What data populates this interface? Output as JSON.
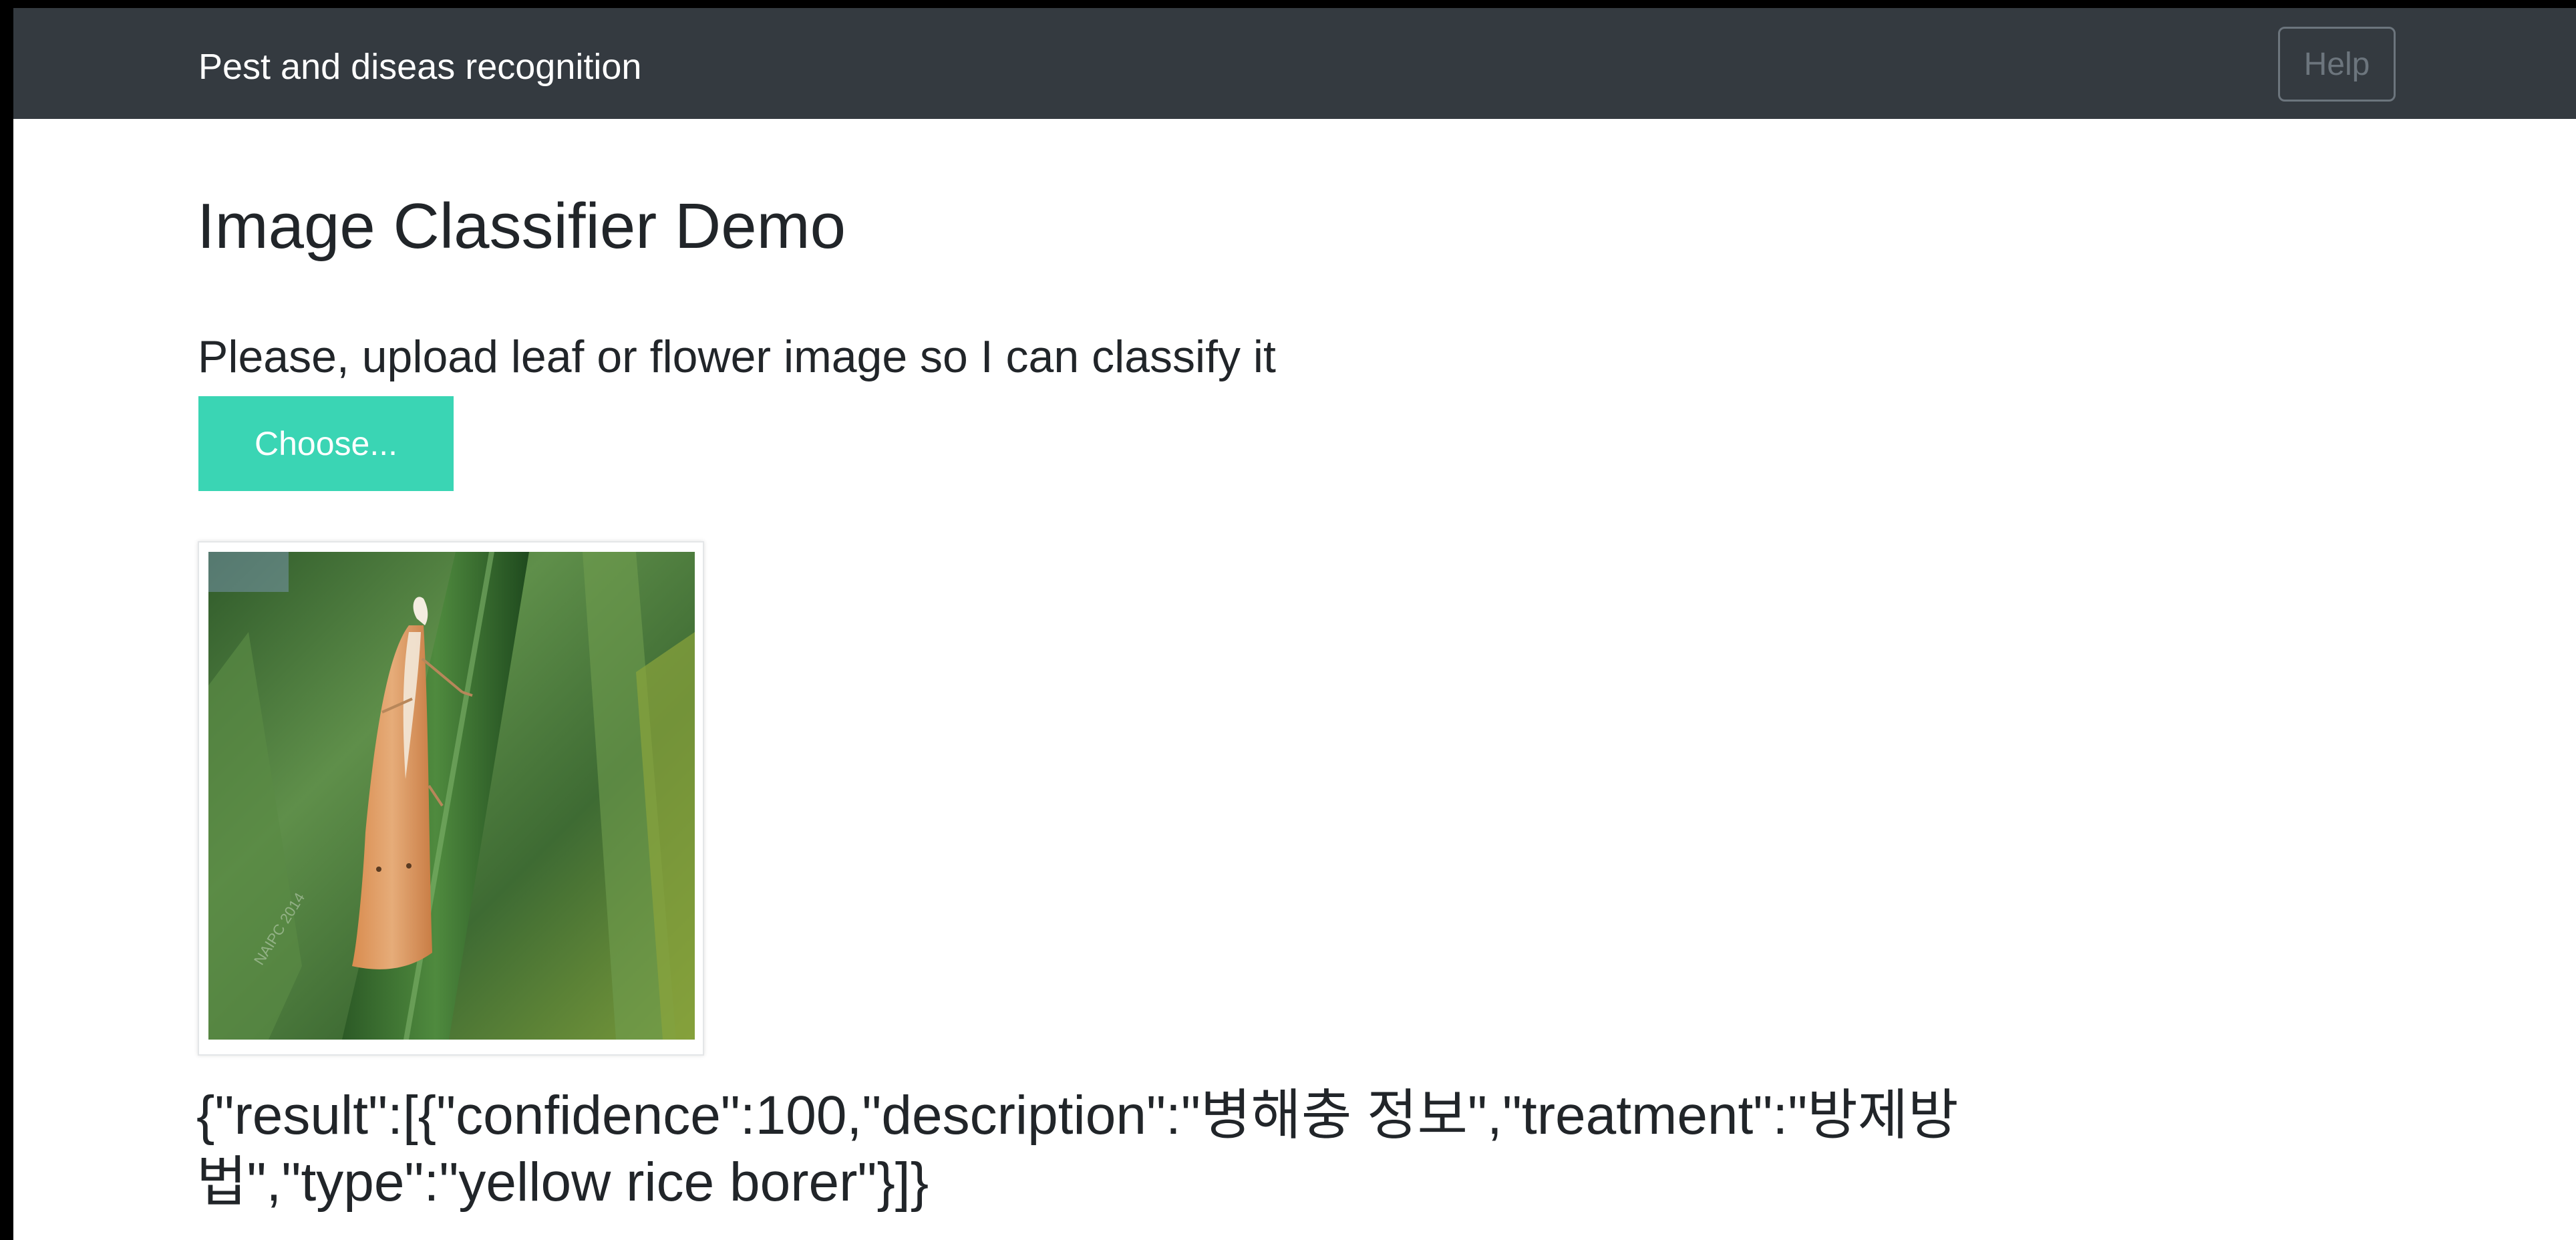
{
  "navbar": {
    "brand": "Pest and diseas recognition",
    "help_label": "Help"
  },
  "main": {
    "title": "Image Classifier Demo",
    "instruction": "Please, upload leaf or flower image so I can classify it",
    "choose_label": "Choose...",
    "preview": {
      "watermark": "NAIPC 2014"
    },
    "result_text": "{\"result\":[{\"confidence\":100,\"description\":\"병해충 정보\",\"treatment\":\"방제방법\",\"type\":\"yellow rice borer\"}]}"
  },
  "colors": {
    "navbar_bg": "#343a40",
    "accent": "#3ad5b4",
    "text": "#212529",
    "muted": "#6c757d"
  }
}
